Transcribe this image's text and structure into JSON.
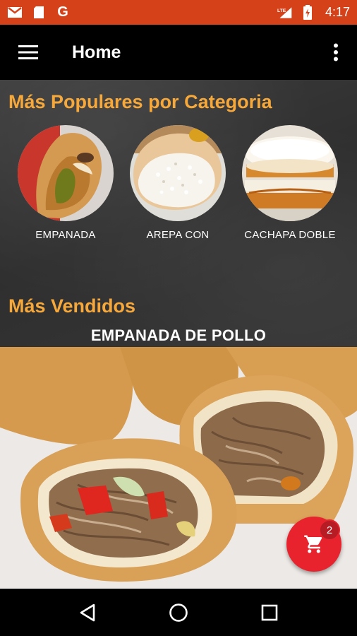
{
  "status_bar": {
    "time": "4:17",
    "network": "LTE",
    "icons": [
      "gmail-icon",
      "sd-card-icon",
      "google-icon",
      "lte-signal-icon",
      "battery-charging-icon"
    ],
    "google_letter": "G"
  },
  "app_bar": {
    "title": "Home",
    "menu_icon": "hamburger-menu-icon",
    "overflow_icon": "more-vertical-icon"
  },
  "popular": {
    "title": "Más Populares por Categoria",
    "items": [
      {
        "label": "EMPANADA"
      },
      {
        "label": "AREPA CON"
      },
      {
        "label": "CACHAPA DOBLE"
      }
    ]
  },
  "best_sellers": {
    "title": "Más Vendidos",
    "featured_name": "EMPANADA DE POLLO"
  },
  "cart": {
    "count": "2",
    "icon": "shopping-cart-icon",
    "color": "#e8232e"
  },
  "nav": {
    "back_icon": "back-triangle-icon",
    "home_icon": "home-circle-icon",
    "recents_icon": "recents-square-icon"
  },
  "colors": {
    "status_bar": "#d5421a",
    "accent": "#f6a83b",
    "fab": "#e8232e"
  }
}
